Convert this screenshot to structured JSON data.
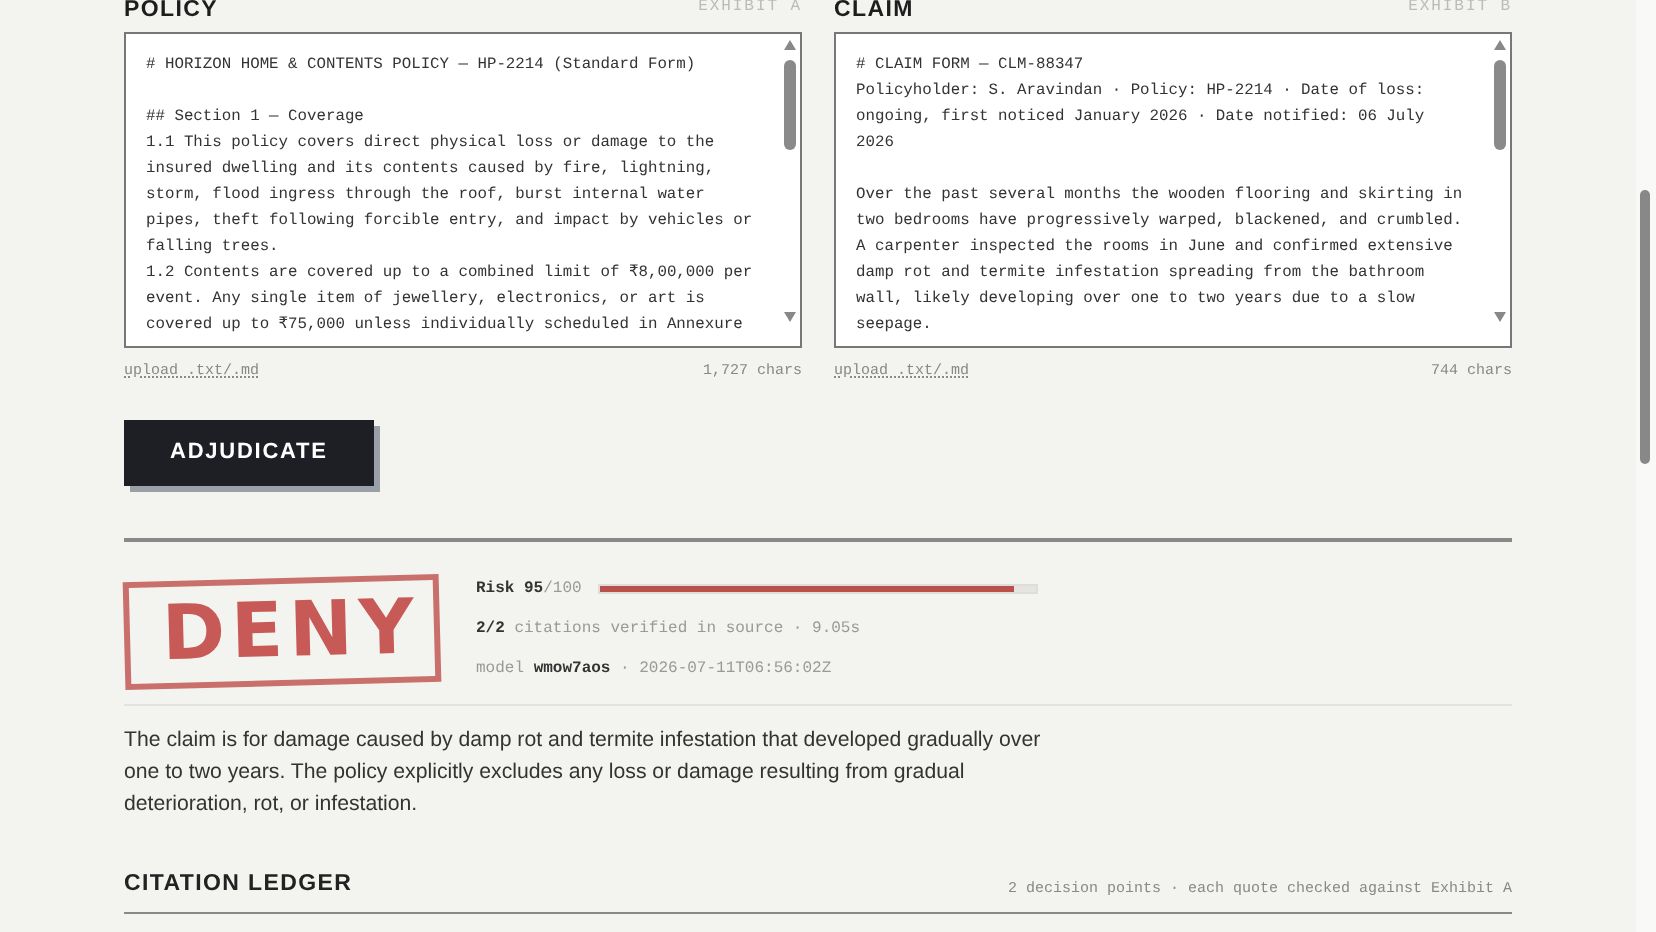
{
  "exhibits": [
    {
      "title": "POLICY",
      "tag": "EXHIBIT A",
      "text": "# HORIZON HOME & CONTENTS POLICY — HP-2214 (Standard Form)\n\n## Section 1 — Coverage\n1.1 This policy covers direct physical loss or damage to the insured dwelling and its contents caused by fire, lightning, storm, flood ingress through the roof, burst internal water pipes, theft following forcible entry, and impact by vehicles or falling trees.\n1.2 Contents are covered up to a combined limit of ₹8,00,000 per event. Any single item of jewellery, electronics, or art is covered up to ₹75,000 unless individually scheduled in Annexure",
      "upload": "upload .txt/.md",
      "count": "1,727 chars"
    },
    {
      "title": "CLAIM",
      "tag": "EXHIBIT B",
      "text": "# CLAIM FORM — CLM-88347\nPolicyholder: S. Aravindan · Policy: HP-2214 · Date of loss: ongoing, first noticed January 2026 · Date notified: 06 July 2026\n\nOver the past several months the wooden flooring and skirting in two bedrooms have progressively warped, blackened, and crumbled. A carpenter inspected the rooms in June and confirmed extensive damp rot and termite infestation spreading from the bathroom wall, likely developing over one to two years due to a slow seepage.",
      "upload": "upload .txt/.md",
      "count": "744 chars"
    }
  ],
  "action": "ADJUDICATE",
  "verdict": {
    "stamp": "DENY",
    "risk_label": "Risk",
    "risk_value": "95",
    "risk_max": "/100",
    "level": 0.95,
    "citations": "2/2",
    "citations_text": "citations verified in source · 9.05s",
    "model_label": "model",
    "model": "wmow7aos",
    "timestamp": "· 2026-07-11T06:56:02Z",
    "summary": "The claim is for damage caused by damp rot and termite infestation that developed gradually over one to two years. The policy explicitly excludes any loss or damage resulting from gradual deterioration, rot, or infestation."
  },
  "ledger": {
    "title": "CITATION LEDGER",
    "note": "2 decision points · each quote checked against Exhibit A"
  }
}
